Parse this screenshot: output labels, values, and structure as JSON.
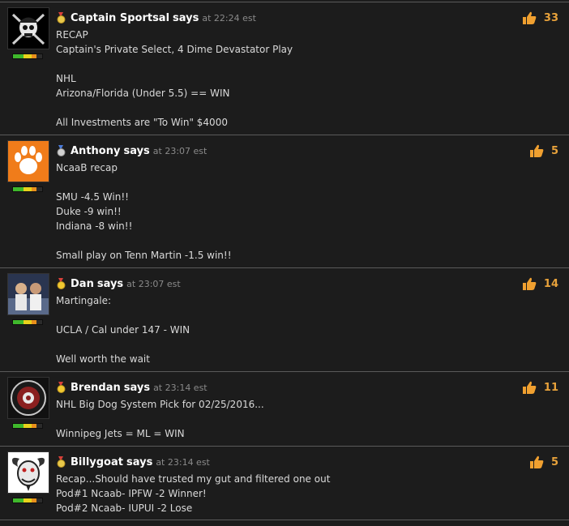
{
  "posts": [
    {
      "author": "Captain Sportsal",
      "says": "says",
      "at": "at 22:24 est",
      "lines": [
        "RECAP",
        "Captain's Private Select, 4 Dime Devastator Play",
        "",
        "NHL",
        "Arizona/Florida (Under 5.5) == WIN",
        "",
        "All Investments are \"To Win\" $4000"
      ],
      "likes": "33",
      "medal": "red",
      "avatar": "pirate-skull"
    },
    {
      "author": "Anthony",
      "says": "says",
      "at": "at 23:07 est",
      "lines": [
        "NcaaB recap",
        "",
        "SMU -4.5 Win!!",
        "Duke -9 win!!",
        "Indiana -8 win!!",
        "",
        "Small play on Tenn Martin -1.5 win!!"
      ],
      "likes": "5",
      "medal": "blue",
      "avatar": "tiger-paw"
    },
    {
      "author": "Dan",
      "says": "says",
      "at": "at 23:07 est",
      "lines": [
        "Martingale:",
        "",
        "UCLA / Cal under 147 - WIN",
        "",
        "Well worth the wait"
      ],
      "likes": "14",
      "medal": "gold",
      "avatar": "photo"
    },
    {
      "author": "Brendan",
      "says": "says",
      "at": "at 23:14 est",
      "lines": [
        "NHL Big Dog System Pick for 02/25/2016...",
        "",
        "Winnipeg Jets = ML = WIN"
      ],
      "likes": "11",
      "medal": "gold",
      "avatar": "badge"
    },
    {
      "author": "Billygoat",
      "says": "says",
      "at": "at 23:14 est",
      "lines": [
        "Recap...Should have trusted my gut and filtered one out",
        "Pod#1 Ncaab- IPFW -2 Winner!",
        "Pod#2 Ncaab- IUPUI -2 Lose"
      ],
      "likes": "5",
      "medal": "red",
      "avatar": "goat"
    }
  ],
  "colors": {
    "background": "#1c1c1c",
    "author": "#ffffff",
    "timestamp": "#8a8a8a",
    "like_count": "#e8a23b",
    "thumb": "#f0a030"
  }
}
